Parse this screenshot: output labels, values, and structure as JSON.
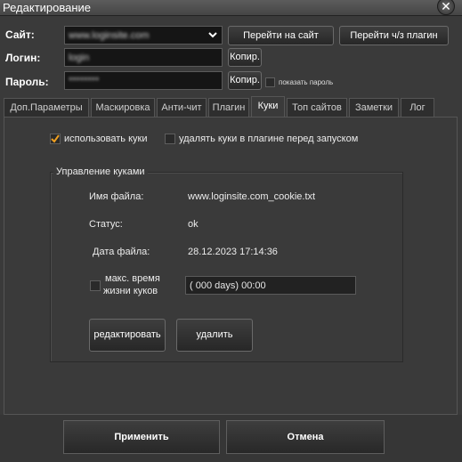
{
  "window": {
    "title": "Редактирование",
    "close_glyph": "✕"
  },
  "form": {
    "site_label": "Сайт:",
    "site_value": "www.loginsite.com",
    "goto_site_label": "Перейти на сайт",
    "goto_plugin_label": "Перейти ч/з плагин",
    "login_label": "Логин:",
    "login_value": "login",
    "copy_label": "Копир.",
    "password_label": "Пароль:",
    "password_value": "********",
    "show_password_label": "показать пароль"
  },
  "tabs": [
    "Доп.Параметры",
    "Маскировка",
    "Анти-чит",
    "Плагин",
    "Куки",
    "Топ сайтов",
    "Заметки",
    "Лог"
  ],
  "active_tab": "Куки",
  "cookies": {
    "use_cookies_label": "использовать куки",
    "use_cookies_checked": true,
    "delete_cookies_label": "удалять куки в плагине перед запуском",
    "delete_cookies_checked": false,
    "group_title": "Управление куками",
    "filename_label": "Имя файла:",
    "filename_value": "www.loginsite.com_cookie.txt",
    "status_label": "Статус:",
    "status_value": "ok",
    "date_label": "Дата файла:",
    "date_value": "28.12.2023 17:14:36",
    "max_lifetime_label_1": "макс. время",
    "max_lifetime_label_2": "жизни куков",
    "max_lifetime_checked": false,
    "max_lifetime_value": "( 000 days) 00:00",
    "edit_label": "редактировать",
    "delete_label": "удалить"
  },
  "footer": {
    "apply_label": "Применить",
    "cancel_label": "Отмена"
  },
  "colors": {
    "background": "#3a3a3a",
    "field_bg": "#151515",
    "check_orange": "#f0a020"
  },
  "icons": {
    "dropdown": "chevron-down-icon",
    "close": "close-icon",
    "check": "checkmark-icon"
  }
}
